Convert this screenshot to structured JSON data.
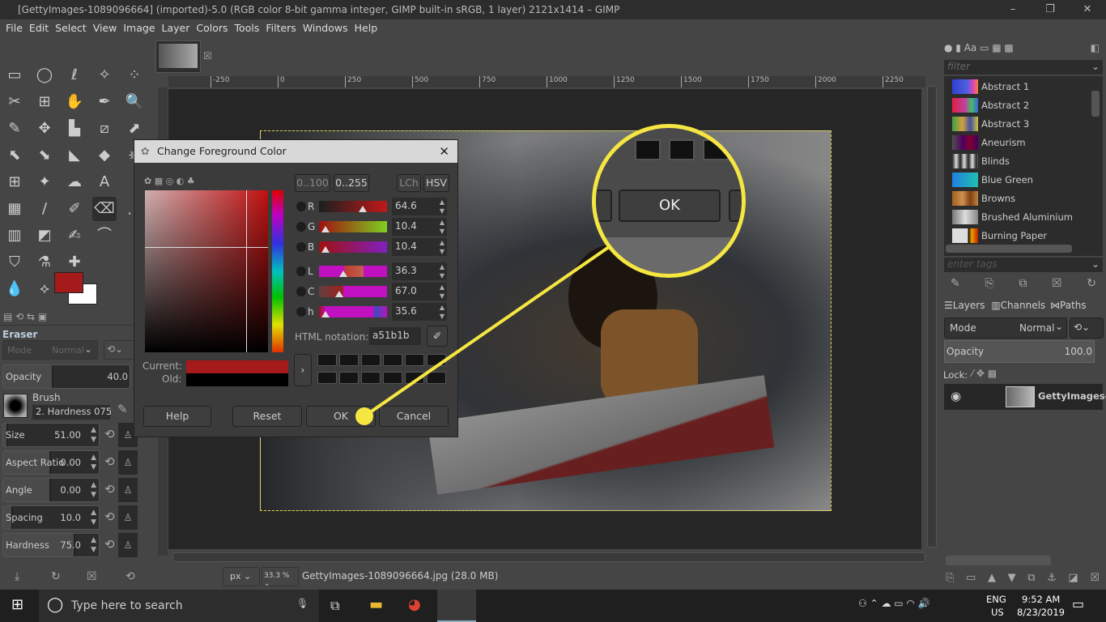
{
  "window": {
    "title": "[GettyImages-1089096664] (imported)-5.0 (RGB color 8-bit gamma integer, GIMP built-in sRGB, 1 layer) 2121x1414 – GIMP",
    "minimize": "–",
    "maximize": "❐",
    "close": "✕"
  },
  "menu": [
    "File",
    "Edit",
    "Select",
    "View",
    "Image",
    "Layer",
    "Colors",
    "Tools",
    "Filters",
    "Windows",
    "Help"
  ],
  "tool_options": {
    "tool_name": "Eraser",
    "mode_label": "Mode",
    "mode_value": "Normal",
    "opacity_label": "Opacity",
    "opacity_value": "40.0",
    "opacity_fraction": 0.4,
    "brush_label": "Brush",
    "brush_value": "2. Hardness 075",
    "params": [
      {
        "label": "Size",
        "value": "51.00",
        "fill": 0.05
      },
      {
        "label": "Aspect Ratio",
        "value": "0.00",
        "fill": 0.5
      },
      {
        "label": "Angle",
        "value": "0.00",
        "fill": 0.5
      },
      {
        "label": "Spacing",
        "value": "10.0",
        "fill": 0.1
      },
      {
        "label": "Hardness",
        "value": "75.0",
        "fill": 0.75
      }
    ]
  },
  "colors": {
    "foreground": "#a51b1b",
    "background": "#ffffff",
    "accent": "#f5e642"
  },
  "ruler": {
    "ticks": [
      "-250",
      "0",
      "250",
      "500",
      "750",
      "1000",
      "1250",
      "1500",
      "1750",
      "2000",
      "2250"
    ]
  },
  "dialog": {
    "title": "Change Foreground Color",
    "range_buttons": [
      "0..100",
      "0..255"
    ],
    "model_buttons": [
      "LCh",
      "HSV"
    ],
    "channels": [
      {
        "label": "R",
        "value": "64.6"
      },
      {
        "label": "G",
        "value": "10.4"
      },
      {
        "label": "B",
        "value": "10.4"
      },
      {
        "label": "L",
        "value": "36.3"
      },
      {
        "label": "C",
        "value": "67.0"
      },
      {
        "label": "h",
        "value": "35.6"
      }
    ],
    "html_notation_label": "HTML notation:",
    "html_notation_value": "a51b1b",
    "current_label": "Current:",
    "old_label": "Old:",
    "current_color": "#a51b1b",
    "old_color": "#000000",
    "help": "Help",
    "reset": "Reset",
    "ok": "OK",
    "cancel": "Cancel"
  },
  "magnifier": {
    "label": "OK"
  },
  "status": {
    "unit": "px",
    "zoom": "33.3 %",
    "file": "GettyImages-1089096664.jpg (28.0 MB)"
  },
  "right_panel": {
    "filter_placeholder": "filter",
    "tags_placeholder": "enter tags",
    "gradients": [
      {
        "name": "Abstract 1",
        "css": "linear-gradient(90deg,#3040d0,#5060e0 60%,#e040c0,#f08030)"
      },
      {
        "name": "Abstract 2",
        "css": "linear-gradient(90deg,#e02040,#c040a0 50%,#40c060,#4060e0)"
      },
      {
        "name": "Abstract 3",
        "css": "linear-gradient(90deg,#40a040,#d0a040 40%,#4050a0,#d0c040)"
      },
      {
        "name": "Aneurism",
        "css": "linear-gradient(90deg,#505050,#500060 40%,#800030,#400060)"
      },
      {
        "name": "Blinds",
        "css": "repeating-linear-gradient(90deg,#222,#ddd 5px,#222 10px)"
      },
      {
        "name": "Blue Green",
        "css": "linear-gradient(90deg,#2080e0,#20c0b0)"
      },
      {
        "name": "Browns",
        "css": "linear-gradient(90deg,#a06020,#d09050 40%,#804010 70%,#c08040)"
      },
      {
        "name": "Brushed Aluminium",
        "css": "linear-gradient(90deg,#777,#ddd 50%,#888)"
      },
      {
        "name": "Burning Paper",
        "css": "linear-gradient(90deg,#ddd 60%,#000 62%,#f0a000 75%,#c02000)"
      }
    ],
    "tabs": [
      "Layers",
      "Channels",
      "Paths"
    ],
    "mode_label": "Mode",
    "mode_value": "Normal",
    "opacity_label": "Opacity",
    "opacity_value": "100.0",
    "lock_label": "Lock:",
    "layer_name": "GettyImages-"
  },
  "taskbar": {
    "search_placeholder": "Type here to search",
    "lang": "ENG",
    "region": "US",
    "time": "9:52 AM",
    "date": "8/23/2019"
  }
}
